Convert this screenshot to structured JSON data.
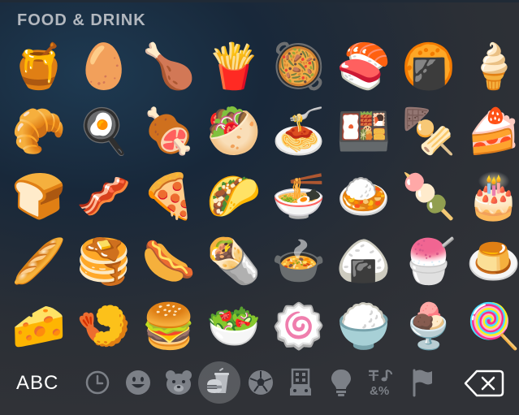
{
  "section": {
    "title": "FOOD & DRINK"
  },
  "emoji_rows": [
    [
      "🍯",
      "🥚",
      "🍗",
      "🍟",
      "🥘",
      "🍣",
      "🍘",
      "🍦"
    ],
    [
      "🥐",
      "🍳",
      "🍖",
      "🥙",
      "🍝",
      "🍱",
      "🍢",
      "🍰"
    ],
    [
      "🍞",
      "🥓",
      "🍕",
      "🌮",
      "🍜",
      "🍛",
      "🍡",
      "🎂"
    ],
    [
      "🥖",
      "🥞",
      "🌭",
      "🌯",
      "🍲",
      "🍙",
      "🍧",
      "🍮"
    ],
    [
      "🧀",
      "🍤",
      "🍔",
      "🥗",
      "🍥",
      "🍚",
      "🍨",
      "🍭"
    ]
  ],
  "bottom_bar": {
    "abc_label": "ABC",
    "categories": [
      {
        "icon": "clock-icon",
        "name": "recent"
      },
      {
        "icon": "smiley-icon",
        "name": "smileys"
      },
      {
        "icon": "bear-icon",
        "name": "animals"
      },
      {
        "icon": "burger-cup-icon",
        "name": "food",
        "selected": true
      },
      {
        "icon": "soccer-ball-icon",
        "name": "activity"
      },
      {
        "icon": "building-car-icon",
        "name": "travel"
      },
      {
        "icon": "lightbulb-icon",
        "name": "objects"
      },
      {
        "icon": "symbols-icon",
        "name": "symbols",
        "text": "&%"
      },
      {
        "icon": "flag-icon",
        "name": "flags"
      }
    ],
    "delete_icon": "backspace-icon"
  },
  "colors": {
    "icon_gray": "#7c8087",
    "text_white": "#ffffff",
    "title_gray": "#b3b8bf"
  }
}
